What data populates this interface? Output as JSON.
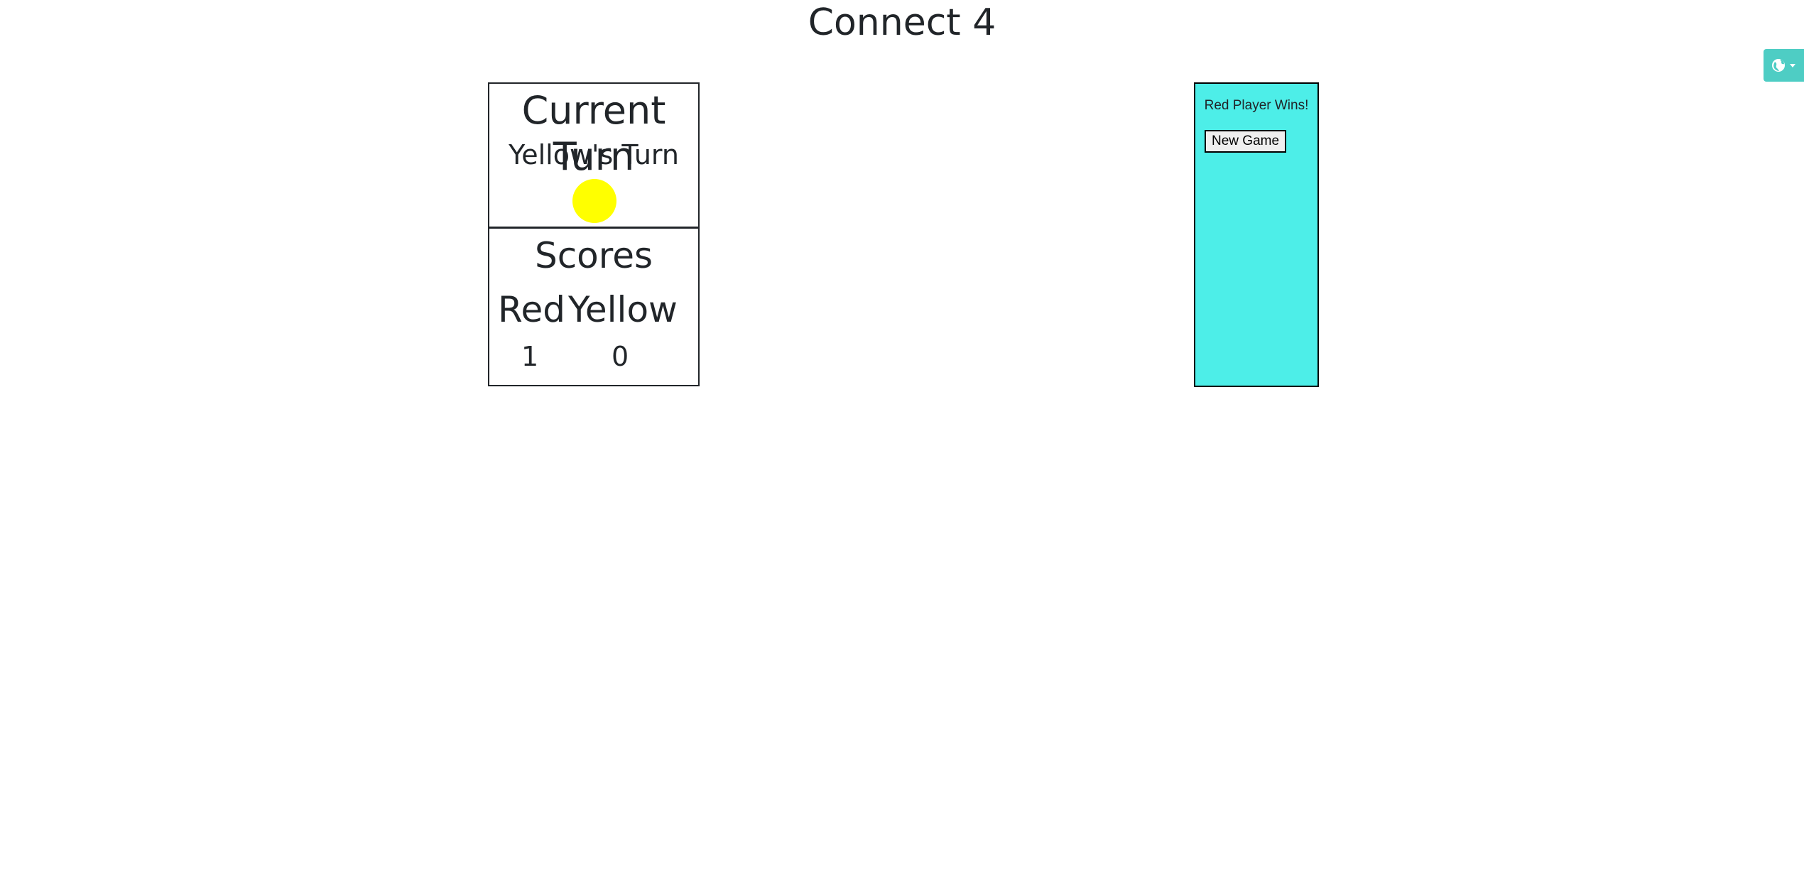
{
  "page": {
    "title": "Connect 4"
  },
  "turn": {
    "heading": "Current Turn",
    "text": "Yellow's Turn",
    "disc_color": "#ffff00"
  },
  "scores": {
    "heading": "Scores",
    "red_label": "Red",
    "yellow_label": "Yellow",
    "red_value": "1",
    "yellow_value": "0"
  },
  "result_panel": {
    "message": "Red Player Wins!",
    "new_game_label": "New Game",
    "background_color": "#4deee8"
  },
  "language_menu": {
    "icon": "globe-icon",
    "caret": "chevron-down-icon",
    "color": "#4ecdc4"
  }
}
